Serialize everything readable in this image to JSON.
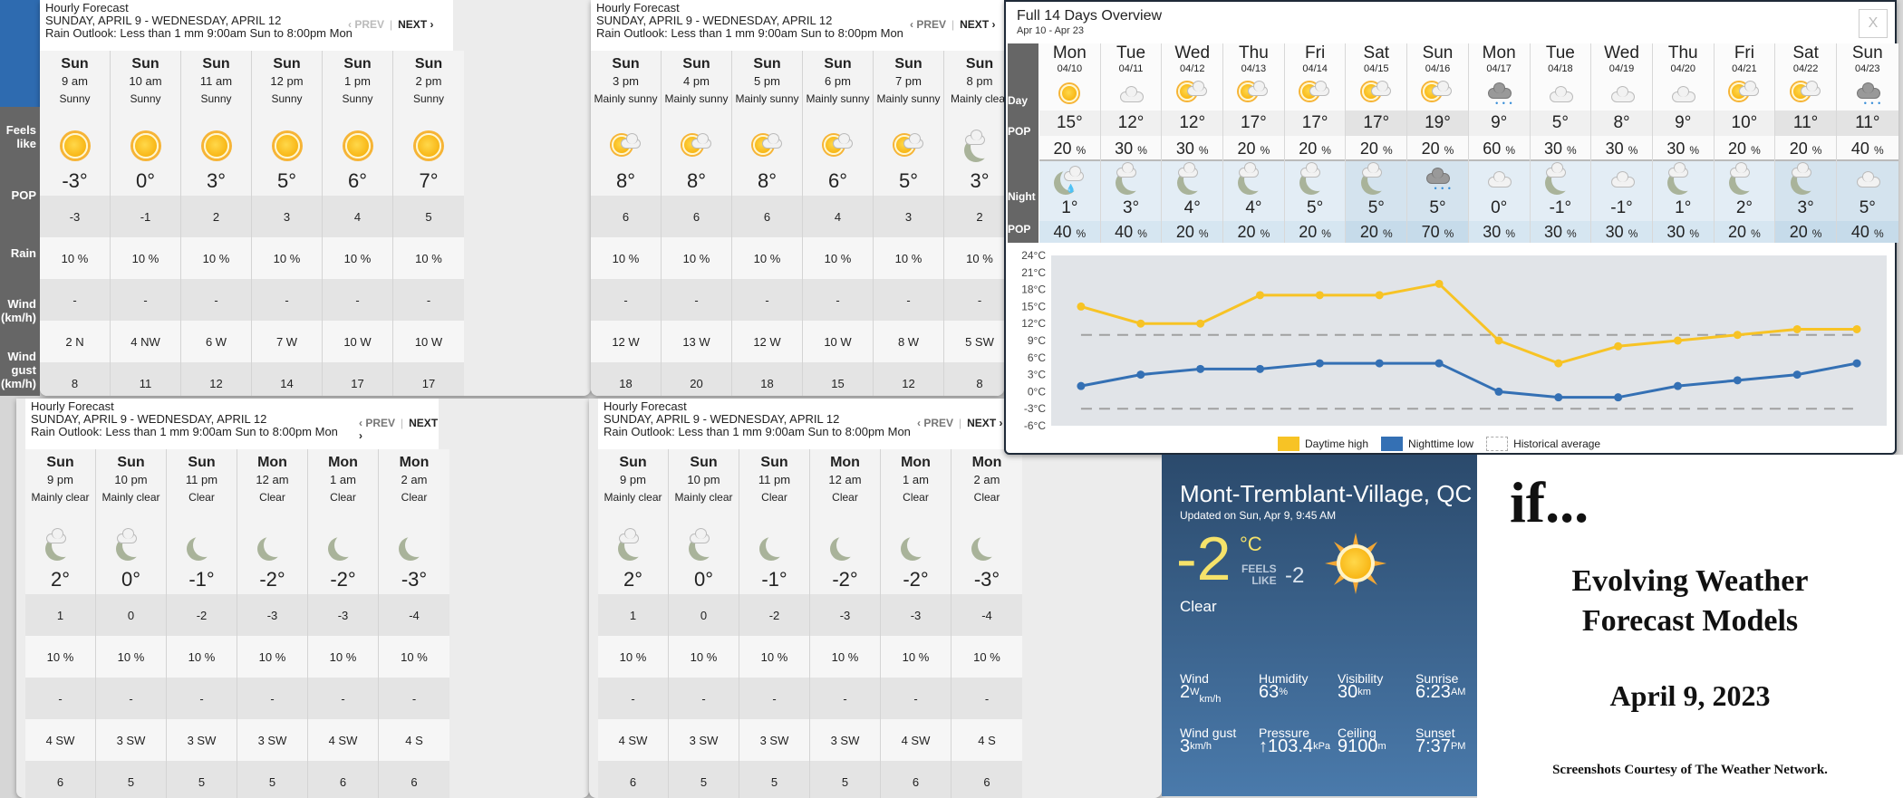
{
  "hourly_header": {
    "title": "Hourly Forecast",
    "range": "SUNDAY, APRIL 9 - WEDNESDAY, APRIL 12",
    "outlook": "Rain Outlook: Less than 1 mm 9:00am Sun to 8:00pm Mon",
    "prev": "‹ PREV",
    "separator": "|",
    "next": "NEXT ›"
  },
  "row_labels": {
    "feels_like": "Feels like",
    "pop": "POP",
    "rain": "Rain",
    "wind": "Wind (km/h)",
    "wind_gust": "Wind gust (km/h)"
  },
  "panels": [
    {
      "hours": [
        {
          "day": "Sun",
          "time": "9 am",
          "cond": "Sunny",
          "icon": "sun",
          "temp": "-3°",
          "feels": "-3",
          "pop": "10 %",
          "rain": "-",
          "wind": "2 N",
          "gust": "8"
        },
        {
          "day": "Sun",
          "time": "10 am",
          "cond": "Sunny",
          "icon": "sun",
          "temp": "0°",
          "feels": "-1",
          "pop": "10 %",
          "rain": "-",
          "wind": "4 NW",
          "gust": "11"
        },
        {
          "day": "Sun",
          "time": "11 am",
          "cond": "Sunny",
          "icon": "sun",
          "temp": "3°",
          "feels": "2",
          "pop": "10 %",
          "rain": "-",
          "wind": "6 W",
          "gust": "12"
        },
        {
          "day": "Sun",
          "time": "12 pm",
          "cond": "Sunny",
          "icon": "sun",
          "temp": "5°",
          "feels": "3",
          "pop": "10 %",
          "rain": "-",
          "wind": "7 W",
          "gust": "14"
        },
        {
          "day": "Sun",
          "time": "1 pm",
          "cond": "Sunny",
          "icon": "sun",
          "temp": "6°",
          "feels": "4",
          "pop": "10 %",
          "rain": "-",
          "wind": "10 W",
          "gust": "17"
        },
        {
          "day": "Sun",
          "time": "2 pm",
          "cond": "Sunny",
          "icon": "sun",
          "temp": "7°",
          "feels": "5",
          "pop": "10 %",
          "rain": "-",
          "wind": "10 W",
          "gust": "17"
        }
      ]
    },
    {
      "hours": [
        {
          "day": "Sun",
          "time": "3 pm",
          "cond": "Mainly sunny",
          "icon": "sun-cloud",
          "temp": "8°",
          "feels": "6",
          "pop": "10 %",
          "rain": "-",
          "wind": "12 W",
          "gust": "18"
        },
        {
          "day": "Sun",
          "time": "4 pm",
          "cond": "Mainly sunny",
          "icon": "sun-cloud",
          "temp": "8°",
          "feels": "6",
          "pop": "10 %",
          "rain": "-",
          "wind": "13 W",
          "gust": "20"
        },
        {
          "day": "Sun",
          "time": "5 pm",
          "cond": "Mainly sunny",
          "icon": "sun-cloud",
          "temp": "8°",
          "feels": "6",
          "pop": "10 %",
          "rain": "-",
          "wind": "12 W",
          "gust": "18"
        },
        {
          "day": "Sun",
          "time": "6 pm",
          "cond": "Mainly sunny",
          "icon": "sun-cloud",
          "temp": "6°",
          "feels": "4",
          "pop": "10 %",
          "rain": "-",
          "wind": "10 W",
          "gust": "15"
        },
        {
          "day": "Sun",
          "time": "7 pm",
          "cond": "Mainly sunny",
          "icon": "sun-cloud",
          "temp": "5°",
          "feels": "3",
          "pop": "10 %",
          "rain": "-",
          "wind": "8 W",
          "gust": "12"
        },
        {
          "day": "Sun",
          "time": "8 pm",
          "cond": "Mainly clear",
          "icon": "moon-cloud",
          "temp": "3°",
          "feels": "2",
          "pop": "10 %",
          "rain": "-",
          "wind": "5 SW",
          "gust": "8"
        }
      ]
    },
    {
      "hours": [
        {
          "day": "Sun",
          "time": "9 pm",
          "cond": "Mainly clear",
          "icon": "moon-cloud",
          "temp": "2°",
          "feels": "1",
          "pop": "10 %",
          "rain": "-",
          "wind": "4 SW",
          "gust": "6"
        },
        {
          "day": "Sun",
          "time": "10 pm",
          "cond": "Mainly clear",
          "icon": "moon-cloud",
          "temp": "0°",
          "feels": "0",
          "pop": "10 %",
          "rain": "-",
          "wind": "3 SW",
          "gust": "5"
        },
        {
          "day": "Sun",
          "time": "11 pm",
          "cond": "Clear",
          "icon": "moon",
          "temp": "-1°",
          "feels": "-2",
          "pop": "10 %",
          "rain": "-",
          "wind": "3 SW",
          "gust": "5"
        },
        {
          "day": "Mon",
          "time": "12 am",
          "cond": "Clear",
          "icon": "moon",
          "temp": "-2°",
          "feels": "-3",
          "pop": "10 %",
          "rain": "-",
          "wind": "3 SW",
          "gust": "5"
        },
        {
          "day": "Mon",
          "time": "1 am",
          "cond": "Clear",
          "icon": "moon",
          "temp": "-2°",
          "feels": "-3",
          "pop": "10 %",
          "rain": "-",
          "wind": "4 SW",
          "gust": "6"
        },
        {
          "day": "Mon",
          "time": "2 am",
          "cond": "Clear",
          "icon": "moon",
          "temp": "-3°",
          "feels": "-4",
          "pop": "10 %",
          "rain": "-",
          "wind": "4 S",
          "gust": "6"
        }
      ]
    },
    {
      "hours": [
        {
          "day": "Sun",
          "time": "9 pm",
          "cond": "Mainly clear",
          "icon": "moon-cloud",
          "temp": "2°",
          "feels": "1",
          "pop": "10 %",
          "rain": "-",
          "wind": "4 SW",
          "gust": "6"
        },
        {
          "day": "Sun",
          "time": "10 pm",
          "cond": "Mainly clear",
          "icon": "moon-cloud",
          "temp": "0°",
          "feels": "0",
          "pop": "10 %",
          "rain": "-",
          "wind": "3 SW",
          "gust": "5"
        },
        {
          "day": "Sun",
          "time": "11 pm",
          "cond": "Clear",
          "icon": "moon",
          "temp": "-1°",
          "feels": "-2",
          "pop": "10 %",
          "rain": "-",
          "wind": "3 SW",
          "gust": "5"
        },
        {
          "day": "Mon",
          "time": "12 am",
          "cond": "Clear",
          "icon": "moon",
          "temp": "-2°",
          "feels": "-3",
          "pop": "10 %",
          "rain": "-",
          "wind": "3 SW",
          "gust": "5"
        },
        {
          "day": "Mon",
          "time": "1 am",
          "cond": "Clear",
          "icon": "moon",
          "temp": "-2°",
          "feels": "-3",
          "pop": "10 %",
          "rain": "-",
          "wind": "4 SW",
          "gust": "6"
        },
        {
          "day": "Mon",
          "time": "2 am",
          "cond": "Clear",
          "icon": "moon",
          "temp": "-3°",
          "feels": "-4",
          "pop": "10 %",
          "rain": "-",
          "wind": "4 S",
          "gust": "6"
        }
      ]
    }
  ],
  "overview": {
    "title": "Full 14 Days Overview",
    "subtitle": "Apr 10 - Apr 23",
    "close": "X",
    "labels": {
      "day": "Day",
      "pop": "POP",
      "night": "Night",
      "npop": "POP"
    },
    "days": [
      {
        "dow": "Mon",
        "date": "04/10",
        "day_icon": "sun",
        "high": "15°",
        "day_pop": "20",
        "night_icon": "moon-rain",
        "low": "1°",
        "night_pop": "40",
        "weekend": false
      },
      {
        "dow": "Tue",
        "date": "04/11",
        "day_icon": "cloud",
        "high": "12°",
        "day_pop": "30",
        "night_icon": "moon-cloud",
        "low": "3°",
        "night_pop": "40",
        "weekend": false
      },
      {
        "dow": "Wed",
        "date": "04/12",
        "day_icon": "sun-cloud",
        "high": "12°",
        "day_pop": "30",
        "night_icon": "moon-cloud",
        "low": "4°",
        "night_pop": "20",
        "weekend": false
      },
      {
        "dow": "Thu",
        "date": "04/13",
        "day_icon": "sun-cloud",
        "high": "17°",
        "day_pop": "20",
        "night_icon": "moon-cloud",
        "low": "4°",
        "night_pop": "20",
        "weekend": false
      },
      {
        "dow": "Fri",
        "date": "04/14",
        "day_icon": "sun-cloud",
        "high": "17°",
        "day_pop": "20",
        "night_icon": "moon-cloud",
        "low": "5°",
        "night_pop": "20",
        "weekend": false
      },
      {
        "dow": "Sat",
        "date": "04/15",
        "day_icon": "sun-cloud",
        "high": "17°",
        "day_pop": "20",
        "night_icon": "moon-cloud",
        "low": "5°",
        "night_pop": "20",
        "weekend": true
      },
      {
        "dow": "Sun",
        "date": "04/16",
        "day_icon": "sun-cloud",
        "high": "19°",
        "day_pop": "20",
        "night_icon": "rain-cloud",
        "low": "5°",
        "night_pop": "70",
        "weekend": true
      },
      {
        "dow": "Mon",
        "date": "04/17",
        "day_icon": "rain-cloud",
        "high": "9°",
        "day_pop": "60",
        "night_icon": "cloud",
        "low": "0°",
        "night_pop": "30",
        "weekend": false
      },
      {
        "dow": "Tue",
        "date": "04/18",
        "day_icon": "cloud",
        "high": "5°",
        "day_pop": "30",
        "night_icon": "moon-cloud",
        "low": "-1°",
        "night_pop": "30",
        "weekend": false
      },
      {
        "dow": "Wed",
        "date": "04/19",
        "day_icon": "cloud",
        "high": "8°",
        "day_pop": "30",
        "night_icon": "cloud",
        "low": "-1°",
        "night_pop": "30",
        "weekend": false
      },
      {
        "dow": "Thu",
        "date": "04/20",
        "day_icon": "cloud",
        "high": "9°",
        "day_pop": "30",
        "night_icon": "moon-cloud",
        "low": "1°",
        "night_pop": "30",
        "weekend": false
      },
      {
        "dow": "Fri",
        "date": "04/21",
        "day_icon": "sun-cloud",
        "high": "10°",
        "day_pop": "20",
        "night_icon": "moon-cloud",
        "low": "2°",
        "night_pop": "20",
        "weekend": false
      },
      {
        "dow": "Sat",
        "date": "04/22",
        "day_icon": "sun-cloud",
        "high": "11°",
        "day_pop": "20",
        "night_icon": "moon-cloud",
        "low": "3°",
        "night_pop": "20",
        "weekend": true
      },
      {
        "dow": "Sun",
        "date": "04/23",
        "day_icon": "rain-cloud",
        "high": "11°",
        "day_pop": "40",
        "night_icon": "cloud",
        "low": "5°",
        "night_pop": "40",
        "weekend": true
      }
    ],
    "pct": "%"
  },
  "chart_data": {
    "type": "line",
    "title": "",
    "x": [
      "04/10",
      "04/11",
      "04/12",
      "04/13",
      "04/14",
      "04/15",
      "04/16",
      "04/17",
      "04/18",
      "04/19",
      "04/20",
      "04/21",
      "04/22",
      "04/23"
    ],
    "series": [
      {
        "name": "Daytime high",
        "color": "#f7c325",
        "values": [
          15,
          12,
          12,
          17,
          17,
          17,
          19,
          9,
          5,
          8,
          9,
          10,
          11,
          11
        ]
      },
      {
        "name": "Nighttime low",
        "color": "#3470b4",
        "values": [
          1,
          3,
          4,
          4,
          5,
          5,
          5,
          0,
          -1,
          -1,
          1,
          2,
          3,
          5
        ]
      },
      {
        "name": "Historical average",
        "color": "#999999",
        "style": "dashed",
        "values_high": 10,
        "values_low": -3
      }
    ],
    "yticks": [
      "24°C",
      "21°C",
      "18°C",
      "15°C",
      "12°C",
      "9°C",
      "6°C",
      "3°C",
      "0°C",
      "-3°C",
      "-6°C"
    ],
    "ylim": [
      -6,
      24
    ],
    "legend_position": "bottom-center",
    "grid": false
  },
  "current": {
    "location": "Mont-Tremblant-Village, QC",
    "updated": "Updated on Sun, Apr 9, 9:45 AM",
    "temp": "-2",
    "unit": "°C",
    "feels_label_1": "FEELS",
    "feels_label_2": "LIKE",
    "feels_value": "-2",
    "condition": "Clear",
    "stats": [
      {
        "label": "Wind",
        "value": "2",
        "sup": "W",
        "sub": "km/h"
      },
      {
        "label": "Humidity",
        "value": "63",
        "sup": "%"
      },
      {
        "label": "Visibility",
        "value": "30",
        "sup": "km"
      },
      {
        "label": "Sunrise",
        "value": "6:23",
        "sup": "AM"
      },
      {
        "label": "Wind gust",
        "value": "3",
        "sup": "km/h"
      },
      {
        "label": "Pressure",
        "value": "↑103.4",
        "sup": "kPa"
      },
      {
        "label": "Ceiling",
        "value": "9100",
        "sup": "m"
      },
      {
        "label": "Sunset",
        "value": "7:37",
        "sup": "PM"
      }
    ]
  },
  "card": {
    "if": "if...",
    "title_line1": "Evolving Weather",
    "title_line2": "Forecast Models",
    "date": "April 9, 2023",
    "credit": "Screenshots Courtesy of The Weather Network."
  }
}
